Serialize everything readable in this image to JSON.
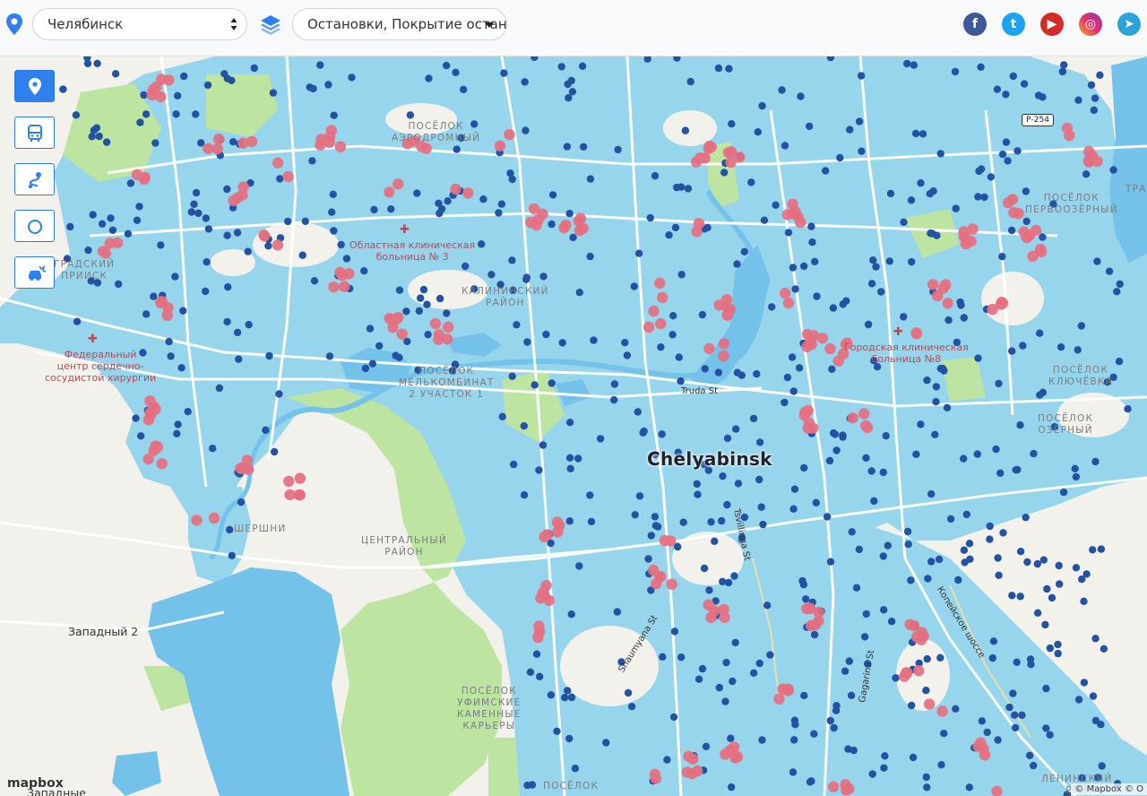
{
  "header": {
    "city_value": "Челябинск",
    "layers_value": "Остановки, Покрытие останов",
    "social": [
      "facebook",
      "twitter",
      "youtube",
      "instagram",
      "telegram"
    ]
  },
  "tools": [
    {
      "name": "stops-tool-button",
      "icon": "map-pin-icon",
      "active": true
    },
    {
      "name": "routes-tool-button",
      "icon": "bus-icon",
      "active": false
    },
    {
      "name": "path-tool-button",
      "icon": "route-path-icon",
      "active": false
    },
    {
      "name": "radius-tool-button",
      "icon": "circle-icon",
      "active": false
    },
    {
      "name": "traffic-tool-button",
      "icon": "car-crash-icon",
      "active": false
    }
  ],
  "map": {
    "city_label": "Chelyabinsk",
    "districts": [
      {
        "text": "ПОСЁЛОК\nАЭРОДРОМНЫЙ"
      },
      {
        "text": "КАЛИНИНСКИЙ\nРАЙОН"
      },
      {
        "text": "ПОСЁЛОК\nМЕЛЬКОМБИНАТ\n2 УЧАСТОК 1"
      },
      {
        "text": "ЦЕНТРАЛЬНЫЙ\nРАЙОН"
      },
      {
        "text": "ПОСЁЛОК\nУФИМСКИЕ\nКАМЕННЫЕ\nКАРЬЕРЫ"
      },
      {
        "text": "ШЕРШНИ"
      },
      {
        "text": "ГРАДСКИЙ\nПРИИСК"
      },
      {
        "text": "ПОСЁЛОК\nПЕРВООЗЁРНЫЙ"
      },
      {
        "text": "ПОСЁЛОК\nКЛЮЧЁВКА"
      },
      {
        "text": "ПОСЁЛОК\nОЗЁРНЫЙ"
      },
      {
        "text": "ЛЕНИНСКИЙ\nРАЙ"
      },
      {
        "text": "ПОСЁЛОК"
      },
      {
        "text": "ТРА"
      }
    ],
    "hospitals": [
      {
        "text": "Областная клиническая\nбольница № 3"
      },
      {
        "text": "Федеральный\nцентр сердечно-\nсосудистой хирургии"
      },
      {
        "text": "Городская клиническая\nбольница №8"
      }
    ],
    "places": [
      "Западный 2",
      "Западные"
    ],
    "streets": [
      "Truda St",
      "Tsvillinga St",
      "Shaumyana St",
      "Gagarina St",
      "Копейское шоссе"
    ],
    "road_shield": "Р-254",
    "attribution": "© Mapbox © O",
    "mapbox_logo": "mapbox"
  },
  "colors": {
    "coverage": "#8fd3ec",
    "stop_dot": "#2452a3",
    "uncovered_dot": "#e56f80",
    "water": "#74c2ea",
    "park": "#bde4a1",
    "accent": "#2f80ed"
  }
}
